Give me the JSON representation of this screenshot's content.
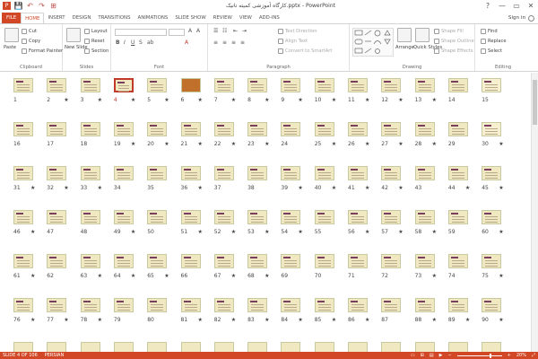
{
  "window": {
    "title": "کارگاه آموزشی کمیته تانیک.pptx - PowerPoint",
    "help": "?",
    "minimize": "—",
    "restore": "▭",
    "close": "✕"
  },
  "qat": [
    "💾",
    "↶",
    "↷",
    "⊞"
  ],
  "tabs": [
    {
      "label": "FILE",
      "key": "file"
    },
    {
      "label": "HOME",
      "key": "home",
      "active": true
    },
    {
      "label": "INSERT",
      "key": "insert"
    },
    {
      "label": "DESIGN",
      "key": "design"
    },
    {
      "label": "TRANSITIONS",
      "key": "transitions"
    },
    {
      "label": "ANIMATIONS",
      "key": "animations"
    },
    {
      "label": "SLIDE SHOW",
      "key": "slideshow"
    },
    {
      "label": "REVIEW",
      "key": "review"
    },
    {
      "label": "VIEW",
      "key": "view"
    },
    {
      "label": "ADD-INS",
      "key": "addins"
    }
  ],
  "signin": "Sign in",
  "ribbon": {
    "clipboard": {
      "label": "Clipboard",
      "paste": "Paste",
      "cut": "Cut",
      "copy": "Copy",
      "format_painter": "Format Painter"
    },
    "slides": {
      "label": "Slides",
      "new_slide": "New Slide",
      "layout": "Layout",
      "reset": "Reset",
      "section": "Section"
    },
    "font": {
      "label": "Font"
    },
    "paragraph": {
      "label": "Paragraph",
      "text_direction": "Text Direction",
      "align_text": "Align Text",
      "convert": "Convert to SmartArt"
    },
    "drawing": {
      "label": "Drawing",
      "arrange": "Arrange",
      "quick_styles": "Quick Styles",
      "shape_fill": "Shape Fill",
      "shape_outline": "Shape Outline",
      "shape_effects": "Shape Effects"
    },
    "editing": {
      "label": "Editing",
      "find": "Find",
      "replace": "Replace",
      "select": "Select"
    }
  },
  "slides": [
    {
      "n": "1",
      "star": false
    },
    {
      "n": "2",
      "star": true
    },
    {
      "n": "3",
      "star": true
    },
    {
      "n": "4",
      "star": true,
      "selected": true
    },
    {
      "n": "5",
      "star": true
    },
    {
      "n": "6",
      "star": true
    },
    {
      "n": "7",
      "star": true
    },
    {
      "n": "8",
      "star": true
    },
    {
      "n": "9",
      "star": true
    },
    {
      "n": "10",
      "star": true
    },
    {
      "n": "11",
      "star": true
    },
    {
      "n": "12",
      "star": true
    },
    {
      "n": "13",
      "star": true
    },
    {
      "n": "14",
      "star": false
    },
    {
      "n": "15",
      "star": false
    },
    {
      "n": "16",
      "star": false
    },
    {
      "n": "17",
      "star": false
    },
    {
      "n": "18",
      "star": false
    },
    {
      "n": "19",
      "star": true
    },
    {
      "n": "20",
      "star": true
    },
    {
      "n": "21",
      "star": true
    },
    {
      "n": "22",
      "star": true
    },
    {
      "n": "23",
      "star": true
    },
    {
      "n": "24",
      "star": false
    },
    {
      "n": "25",
      "star": true
    },
    {
      "n": "26",
      "star": true
    },
    {
      "n": "27",
      "star": true
    },
    {
      "n": "28",
      "star": true
    },
    {
      "n": "29",
      "star": false
    },
    {
      "n": "30",
      "star": true
    },
    {
      "n": "31",
      "star": true
    },
    {
      "n": "32",
      "star": true
    },
    {
      "n": "33",
      "star": true
    },
    {
      "n": "34",
      "star": false
    },
    {
      "n": "35",
      "star": false
    },
    {
      "n": "36",
      "star": true
    },
    {
      "n": "37",
      "star": false
    },
    {
      "n": "38",
      "star": false
    },
    {
      "n": "39",
      "star": true
    },
    {
      "n": "40",
      "star": true
    },
    {
      "n": "41",
      "star": true
    },
    {
      "n": "42",
      "star": true
    },
    {
      "n": "43",
      "star": false
    },
    {
      "n": "44",
      "star": true
    },
    {
      "n": "45",
      "star": true
    },
    {
      "n": "46",
      "star": true
    },
    {
      "n": "47",
      "star": false
    },
    {
      "n": "48",
      "star": false
    },
    {
      "n": "49",
      "star": true
    },
    {
      "n": "50",
      "star": false
    },
    {
      "n": "51",
      "star": true
    },
    {
      "n": "52",
      "star": true
    },
    {
      "n": "53",
      "star": true
    },
    {
      "n": "54",
      "star": true
    },
    {
      "n": "55",
      "star": false
    },
    {
      "n": "56",
      "star": true
    },
    {
      "n": "57",
      "star": true
    },
    {
      "n": "58",
      "star": true
    },
    {
      "n": "59",
      "star": false
    },
    {
      "n": "60",
      "star": true
    },
    {
      "n": "61",
      "star": true
    },
    {
      "n": "62",
      "star": false
    },
    {
      "n": "63",
      "star": true
    },
    {
      "n": "64",
      "star": true
    },
    {
      "n": "65",
      "star": true
    },
    {
      "n": "66",
      "star": false
    },
    {
      "n": "67",
      "star": true
    },
    {
      "n": "68",
      "star": true
    },
    {
      "n": "69",
      "star": false
    },
    {
      "n": "70",
      "star": false
    },
    {
      "n": "71",
      "star": false
    },
    {
      "n": "72",
      "star": false
    },
    {
      "n": "73",
      "star": true
    },
    {
      "n": "74",
      "star": false
    },
    {
      "n": "75",
      "star": true
    },
    {
      "n": "76",
      "star": true
    },
    {
      "n": "77",
      "star": true
    },
    {
      "n": "78",
      "star": true
    },
    {
      "n": "79",
      "star": false
    },
    {
      "n": "80",
      "star": false
    },
    {
      "n": "81",
      "star": true
    },
    {
      "n": "82",
      "star": true
    },
    {
      "n": "83",
      "star": true
    },
    {
      "n": "84",
      "star": true
    },
    {
      "n": "85",
      "star": true
    },
    {
      "n": "86",
      "star": true
    },
    {
      "n": "87",
      "star": false
    },
    {
      "n": "88",
      "star": true
    },
    {
      "n": "89",
      "star": true
    },
    {
      "n": "90",
      "star": true
    }
  ],
  "status": {
    "slide": "SLIDE 4 OF 106",
    "language": "PERSIAN",
    "zoom": "20%"
  },
  "colors": {
    "accent": "#d24726",
    "thumb_bg": "#efe8c0"
  }
}
